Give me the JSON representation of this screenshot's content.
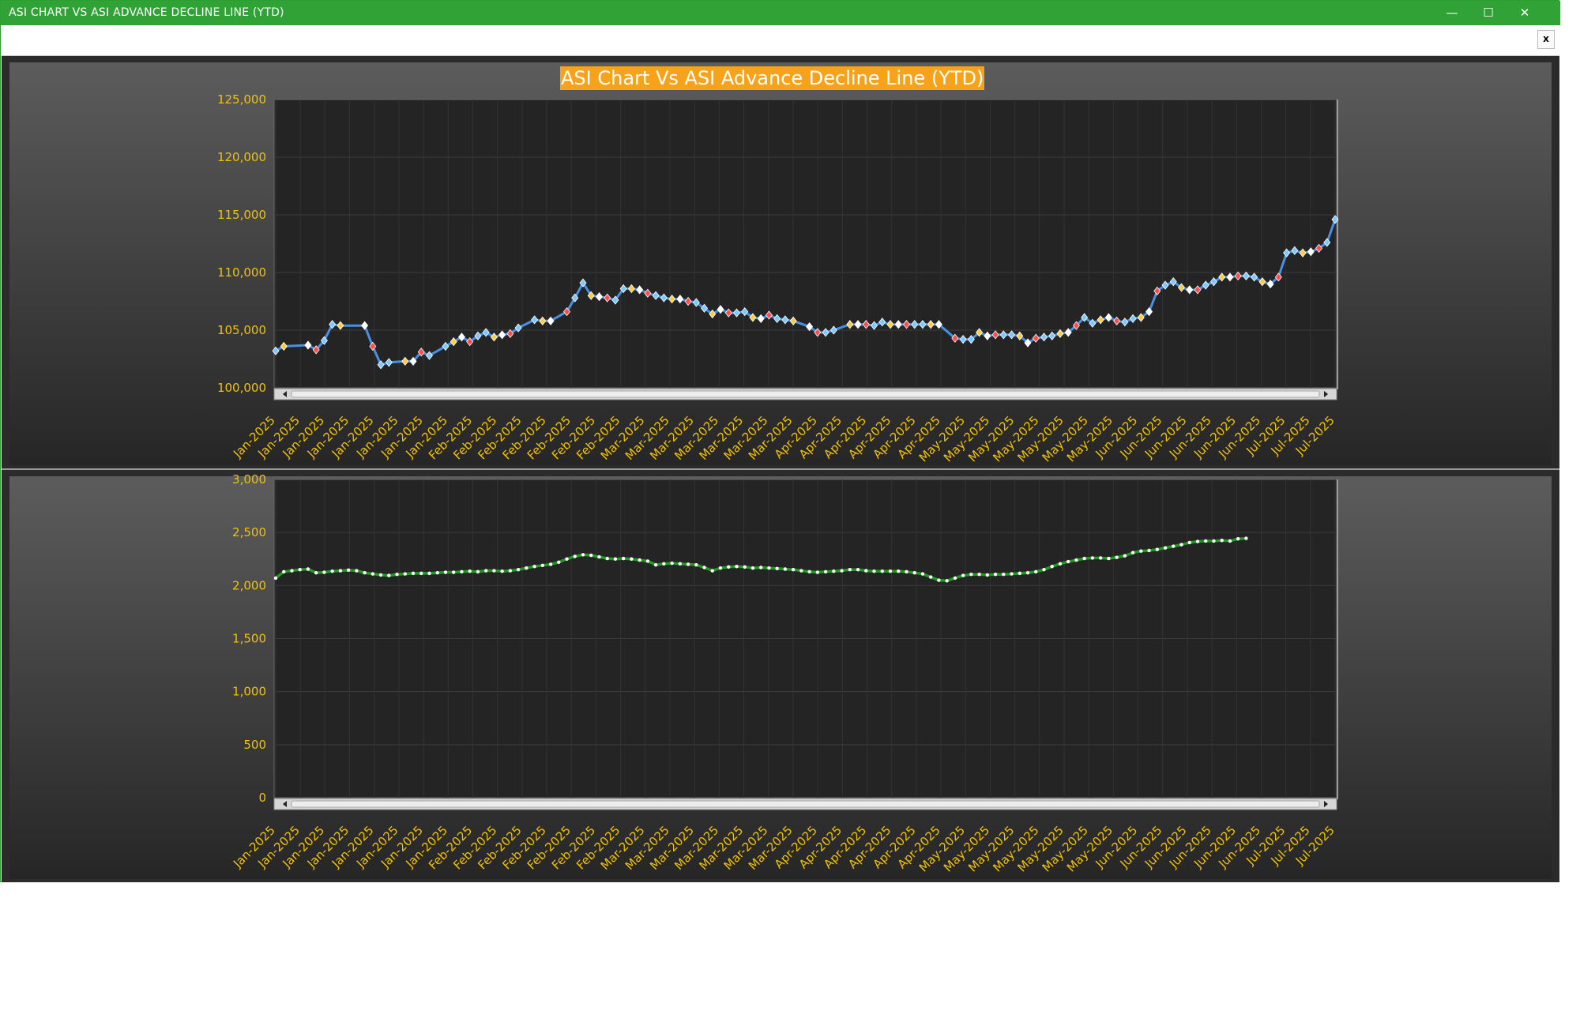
{
  "window": {
    "title": "ASI CHART VS ASI ADVANCE DECLINE LINE (YTD)",
    "minimize_glyph": "—",
    "maximize_glyph": "☐",
    "close_glyph": "✕"
  },
  "toolbar": {
    "close_label": "x"
  },
  "colors": {
    "panel_bg": "#2b2b2b",
    "plot_bg": "#242424",
    "axis_text": "#f2c200",
    "asi_line": "#4a90e2",
    "adl_line": "#1f9a1f",
    "title_bg": "#f7a21b"
  },
  "x_tick_labels": [
    "Jan-2025",
    "Jan-2025",
    "Jan-2025",
    "Jan-2025",
    "Jan-2025",
    "Jan-2025",
    "Jan-2025",
    "Jan-2025",
    "Feb-2025",
    "Feb-2025",
    "Feb-2025",
    "Feb-2025",
    "Feb-2025",
    "Feb-2025",
    "Feb-2025",
    "Mar-2025",
    "Mar-2025",
    "Mar-2025",
    "Mar-2025",
    "Mar-2025",
    "Mar-2025",
    "Mar-2025",
    "Apr-2025",
    "Apr-2025",
    "Apr-2025",
    "Apr-2025",
    "Apr-2025",
    "Apr-2025",
    "May-2025",
    "May-2025",
    "May-2025",
    "May-2025",
    "May-2025",
    "May-2025",
    "May-2025",
    "Jun-2025",
    "Jun-2025",
    "Jun-2025",
    "Jun-2025",
    "Jun-2025",
    "Jun-2025",
    "Jul-2025",
    "Jul-2025",
    "Jul-2025"
  ],
  "chart_data": [
    {
      "type": "line",
      "title": "ASI Chart Vs ASI Advance Decline Line (YTD)",
      "xlabel": "",
      "ylabel": "",
      "ylim": [
        100000,
        125000
      ],
      "yticks": [
        "100,000",
        "105,000",
        "110,000",
        "115,000",
        "120,000",
        "125,000"
      ],
      "grid": true,
      "x_count": 132,
      "series": [
        {
          "x": [
            0,
            1,
            4,
            5,
            6,
            7,
            8,
            11,
            12,
            13,
            14,
            16,
            17,
            18,
            19,
            21,
            22,
            23,
            24,
            25,
            26,
            27,
            28,
            29,
            30,
            32,
            33,
            34,
            36,
            37,
            38,
            39,
            40,
            41,
            42,
            43,
            44,
            45,
            46,
            47,
            48,
            49,
            50,
            51,
            52,
            53,
            54,
            55,
            56,
            57,
            58,
            59,
            60,
            61,
            62,
            63,
            64,
            66,
            67,
            68,
            69,
            71,
            72,
            73,
            74,
            75,
            76,
            77,
            78,
            79,
            80,
            81,
            82,
            84,
            85,
            86,
            87,
            88,
            89,
            90,
            91,
            92,
            93,
            94,
            95,
            96,
            97,
            98,
            99,
            100,
            101,
            102,
            103,
            104,
            105,
            106,
            107,
            108,
            109,
            110,
            111,
            112,
            113,
            114,
            115,
            116,
            117,
            118,
            119,
            120,
            121,
            122,
            123,
            124,
            125,
            126,
            127,
            128,
            129,
            130,
            131
          ],
          "values": [
            103200,
            103600,
            103700,
            103300,
            104100,
            105500,
            105400,
            105400,
            103600,
            102000,
            102200,
            102300,
            102300,
            103100,
            102800,
            103600,
            104000,
            104400,
            104000,
            104500,
            104800,
            104400,
            104600,
            104700,
            105200,
            105900,
            105800,
            105800,
            106600,
            107800,
            109100,
            108000,
            107900,
            107800,
            107600,
            108600,
            108600,
            108500,
            108200,
            108000,
            107800,
            107700,
            107700,
            107500,
            107400,
            106900,
            106400,
            106800,
            106500,
            106500,
            106600,
            106100,
            106000,
            106300,
            106000,
            105900,
            105800,
            105300,
            104800,
            104800,
            105000,
            105500,
            105500,
            105500,
            105400,
            105700,
            105500,
            105500,
            105500,
            105500,
            105500,
            105500,
            105500,
            104300,
            104200,
            104200,
            104800,
            104500,
            104600,
            104600,
            104600,
            104500,
            103900,
            104300,
            104400,
            104500,
            104700,
            104800,
            105400,
            106100,
            105600,
            105900,
            106100,
            105800,
            105700,
            106000,
            106100,
            106600,
            108400,
            108900,
            109200,
            108700,
            108500,
            108500,
            108900,
            109200,
            109600,
            109600,
            109700,
            109700,
            109600,
            109200,
            109000,
            109600,
            111700,
            111900,
            111700,
            111800,
            112100,
            112600,
            114600
          ],
          "marker_colors": [
            "#7ec8ff",
            "#ffcc44",
            "#ffffff",
            "#ff4d4d",
            "#7ec8ff"
          ]
        }
      ]
    },
    {
      "type": "line",
      "title": "",
      "xlabel": "",
      "ylabel": "",
      "ylim": [
        0,
        3000
      ],
      "yticks": [
        "0",
        "500",
        "1,000",
        "1,500",
        "2,000",
        "2,500",
        "3,000"
      ],
      "grid": true,
      "x_count": 132,
      "series": [
        {
          "values": [
            2070,
            2130,
            2140,
            2150,
            2155,
            2120,
            2125,
            2135,
            2140,
            2145,
            2140,
            2120,
            2110,
            2100,
            2095,
            2105,
            2110,
            2115,
            2115,
            2115,
            2120,
            2125,
            2125,
            2130,
            2135,
            2130,
            2140,
            2140,
            2135,
            2140,
            2150,
            2165,
            2180,
            2190,
            2200,
            2220,
            2250,
            2275,
            2290,
            2285,
            2270,
            2255,
            2250,
            2255,
            2250,
            2240,
            2230,
            2195,
            2205,
            2210,
            2205,
            2200,
            2195,
            2170,
            2140,
            2165,
            2175,
            2180,
            2175,
            2165,
            2170,
            2165,
            2160,
            2155,
            2150,
            2140,
            2130,
            2125,
            2130,
            2135,
            2140,
            2150,
            2150,
            2140,
            2135,
            2135,
            2135,
            2135,
            2130,
            2120,
            2110,
            2080,
            2050,
            2045,
            2070,
            2095,
            2105,
            2105,
            2100,
            2105,
            2105,
            2110,
            2115,
            2120,
            2130,
            2150,
            2180,
            2205,
            2225,
            2240,
            2255,
            2260,
            2260,
            2255,
            2265,
            2280,
            2310,
            2325,
            2330,
            2340,
            2355,
            2370,
            2385,
            2405,
            2415,
            2420,
            2420,
            2425,
            2420,
            2440,
            2445
          ]
        }
      ]
    }
  ]
}
